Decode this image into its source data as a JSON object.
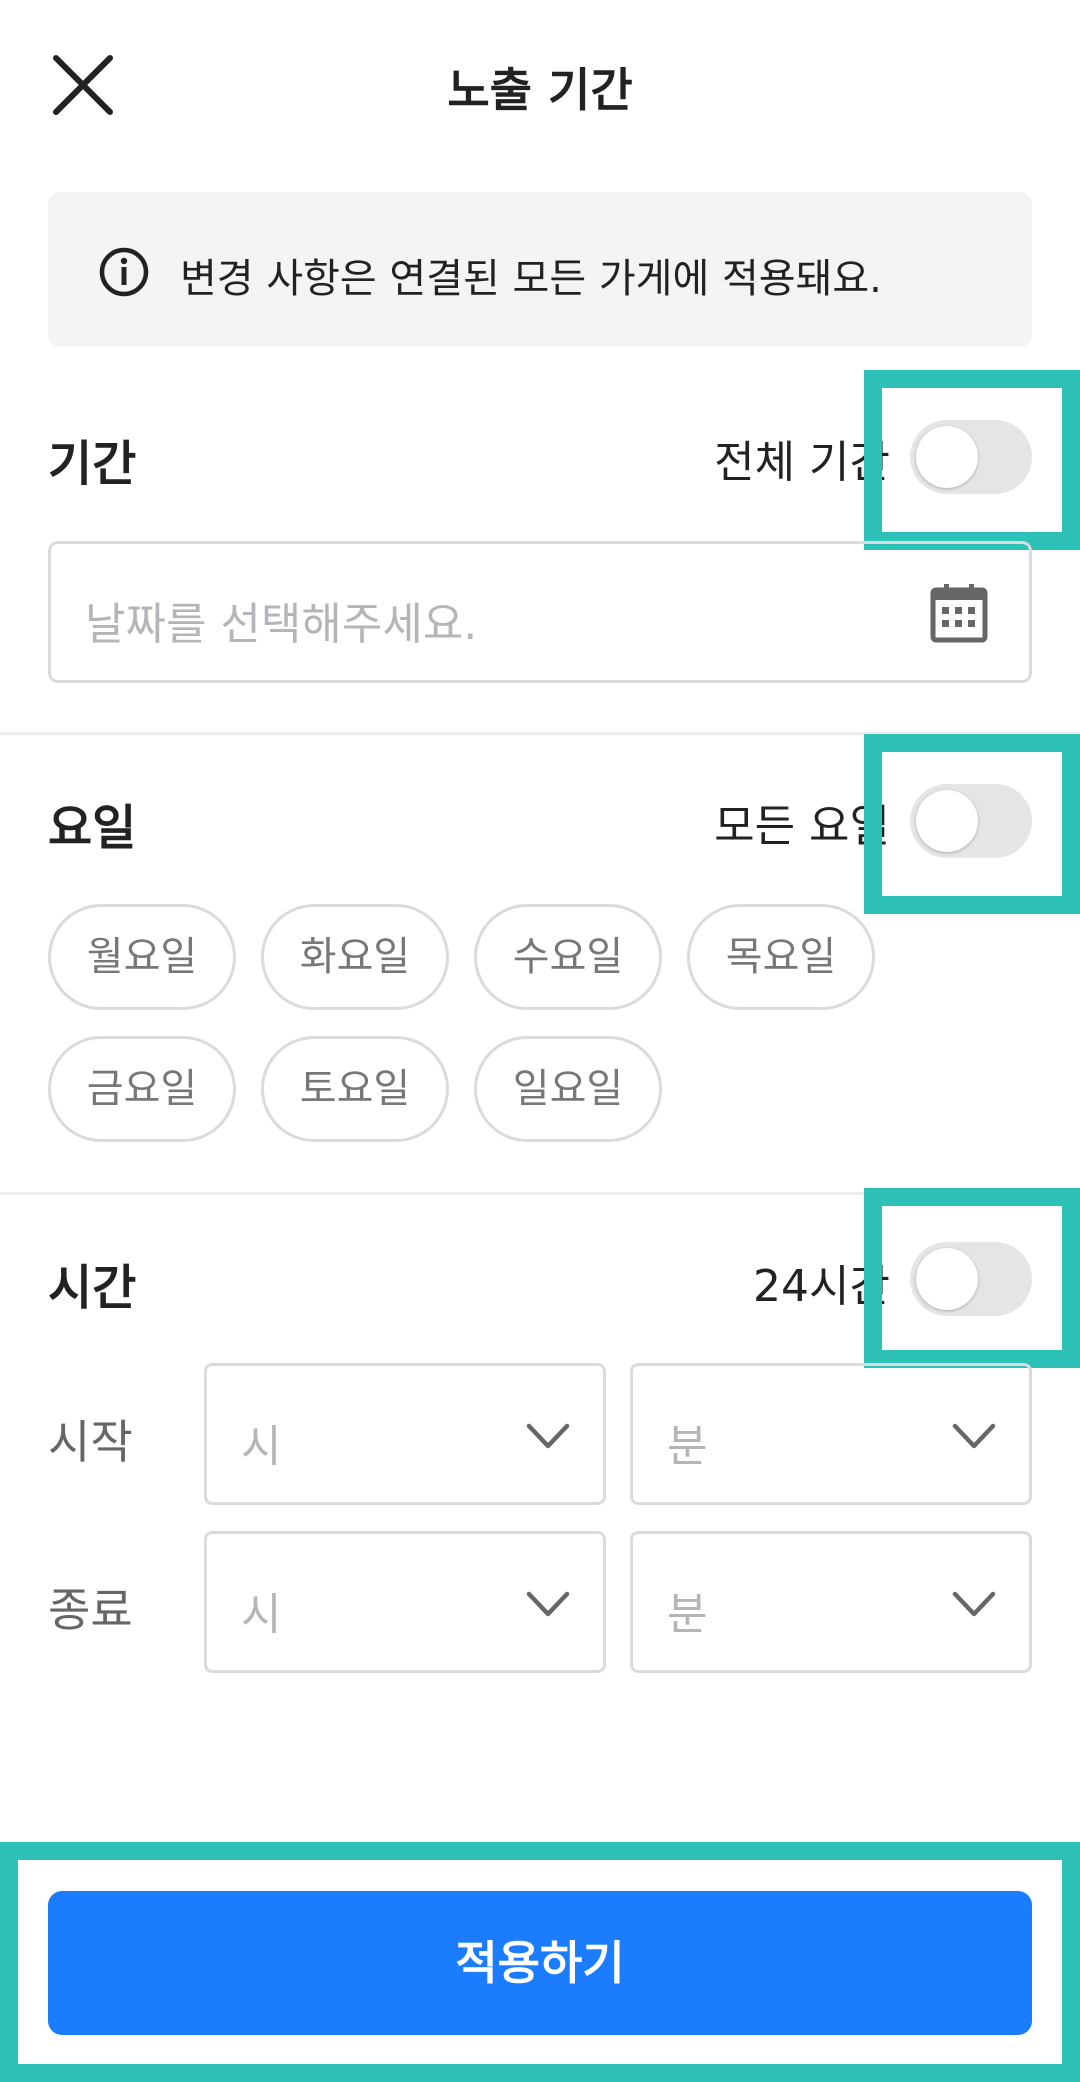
{
  "header": {
    "title": "노출 기간"
  },
  "notice": {
    "text": "변경 사항은 연결된 모든 가게에 적용돼요."
  },
  "period": {
    "title": "기간",
    "toggle_label": "전체 기간",
    "date_placeholder": "날짜를 선택해주세요."
  },
  "weekday": {
    "title": "요일",
    "toggle_label": "모든 요일",
    "days": [
      "월요일",
      "화요일",
      "수요일",
      "목요일",
      "금요일",
      "토요일",
      "일요일"
    ]
  },
  "time": {
    "title": "시간",
    "toggle_label": "24시간",
    "start_label": "시작",
    "end_label": "종료",
    "hour_placeholder": "시",
    "minute_placeholder": "분"
  },
  "footer": {
    "apply_label": "적용하기"
  },
  "colors": {
    "accent": "#1b7dfd",
    "highlight": "#2ec1b8"
  }
}
